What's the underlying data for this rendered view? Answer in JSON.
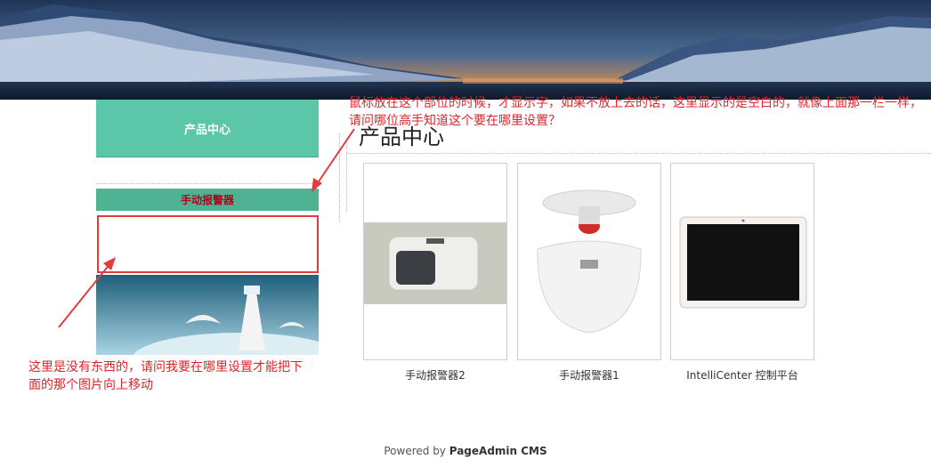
{
  "sidebar": {
    "header_label": "产品中心",
    "item_label": "手动报警器"
  },
  "main": {
    "title": "产品中心",
    "products": [
      {
        "name": "手动报警器2"
      },
      {
        "name": "手动报警器1"
      },
      {
        "name": "IntelliCenter 控制平台"
      }
    ]
  },
  "footer": {
    "prefix": "Powered by ",
    "brand": "PageAdmin CMS"
  },
  "annotations": {
    "top_note": "鼠标放在这个部位的时候，才显示字，如果不放上去的话，这里显示的是空白的，就像上面那一栏一样，请问哪位高手知道这个要在哪里设置？",
    "left_note": "这里是没有东西的，请问我要在哪里设置才能把下面的那个图片向上移动",
    "color": "#d9262a"
  },
  "colors": {
    "accent_green": "#5cc6a8",
    "item_green": "#4fb393",
    "item_text": "#b3001b"
  }
}
